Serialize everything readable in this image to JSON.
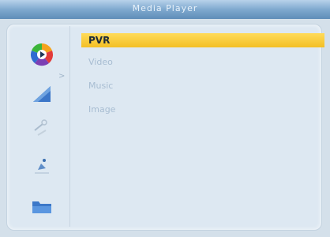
{
  "window": {
    "title": "Media Player"
  },
  "sidebar": {
    "icons": [
      {
        "name": "media-player-icon"
      },
      {
        "name": "picture-settings-icon"
      },
      {
        "name": "tools-icon"
      },
      {
        "name": "satellite-icon"
      },
      {
        "name": "folder-icon"
      }
    ]
  },
  "menu": {
    "items": [
      {
        "label": "PVR",
        "selected": true
      },
      {
        "label": "Video",
        "selected": false
      },
      {
        "label": "Music",
        "selected": false
      },
      {
        "label": "Image",
        "selected": false
      }
    ]
  },
  "colors": {
    "accent": "#f5c437",
    "titlebar": "#6f9ac4",
    "background": "#dde8f2"
  }
}
